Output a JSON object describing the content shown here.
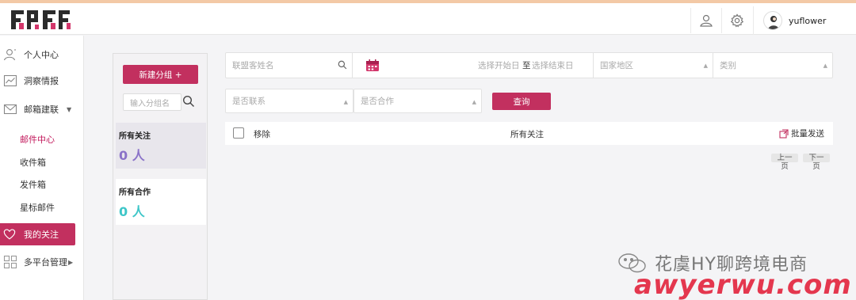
{
  "header": {
    "username": "yuflower",
    "icons": [
      "user-icon",
      "gear-icon"
    ]
  },
  "sidebar": {
    "items": [
      {
        "label": "个人中心",
        "icon": "user-icon"
      },
      {
        "label": "洞察情报",
        "icon": "chart-icon"
      },
      {
        "label": "邮箱建联",
        "icon": "mail-icon"
      },
      {
        "label": "邮件中心"
      },
      {
        "label": "收件箱"
      },
      {
        "label": "发件箱"
      },
      {
        "label": "星标邮件"
      },
      {
        "label": "我的关注",
        "icon": "heart-icon"
      },
      {
        "label": "多平台管理",
        "icon": "grid-icon"
      }
    ]
  },
  "groups": {
    "new_button": "新建分组 +",
    "search_placeholder": "输入分组名",
    "cards": [
      {
        "name": "所有关注",
        "count": "0 人",
        "color": "#8a72c8"
      },
      {
        "name": "所有合作",
        "count": "0 人",
        "color": "#3ec6c8"
      }
    ]
  },
  "filters": {
    "name_placeholder": "联盟客姓名",
    "start_date": "选择开始日",
    "to": "至",
    "end_date": "选择结束日",
    "region": "国家地区",
    "category": "类别",
    "contacted": "是否联系",
    "cooperated": "是否合作",
    "query_button": "查询"
  },
  "list": {
    "remove": "移除",
    "title": "所有关注",
    "bulk_send": "批量发送",
    "prev_top": "上一",
    "prev_bottom": "页",
    "next_top": "下一",
    "next_bottom": "页"
  },
  "watermark": {
    "line1": "花虞HY聊跨境电商",
    "line2": "awyerwu.com"
  },
  "colors": {
    "accent": "#c2305f"
  }
}
